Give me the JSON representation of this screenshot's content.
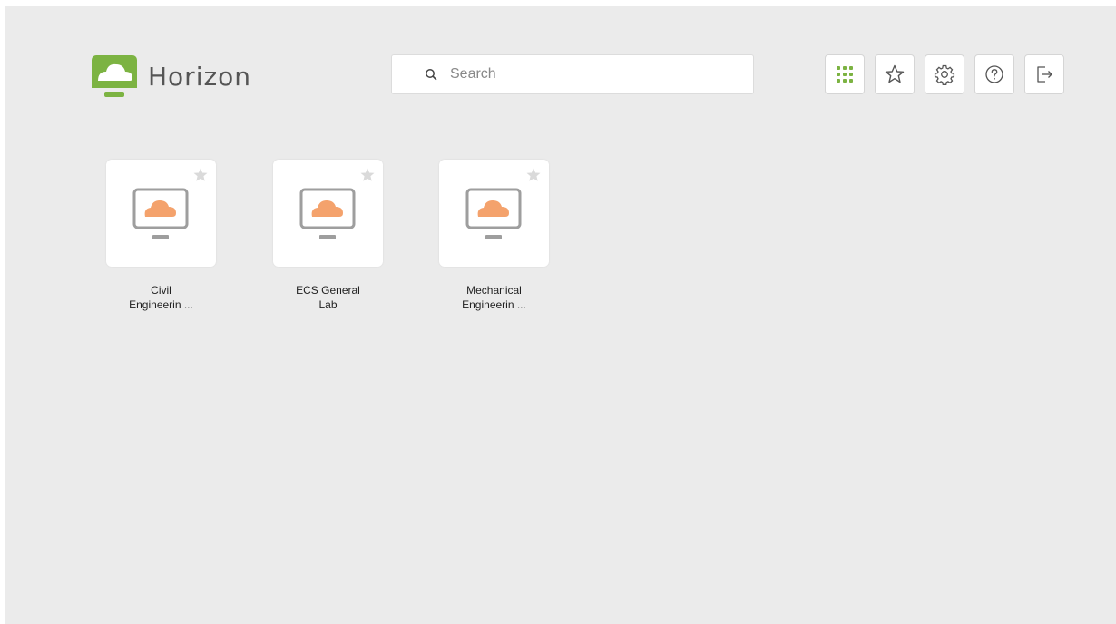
{
  "app": {
    "title": "Horizon",
    "accent_color": "#7cb342",
    "icon_color": "#f4a26c"
  },
  "search": {
    "placeholder": "Search",
    "value": ""
  },
  "toolbar": {
    "buttons": [
      {
        "icon": "app-grid-icon",
        "active": true
      },
      {
        "icon": "favorites-star-icon"
      },
      {
        "icon": "settings-gear-icon"
      },
      {
        "icon": "help-icon"
      },
      {
        "icon": "logout-icon"
      }
    ]
  },
  "desktops": [
    {
      "line1": "Civil",
      "line2": "Engineerin",
      "ellipsis": "..."
    },
    {
      "line1": "ECS General",
      "line2": "Lab",
      "ellipsis": ""
    },
    {
      "line1": "Mechanical",
      "line2": "Engineerin",
      "ellipsis": "..."
    }
  ]
}
